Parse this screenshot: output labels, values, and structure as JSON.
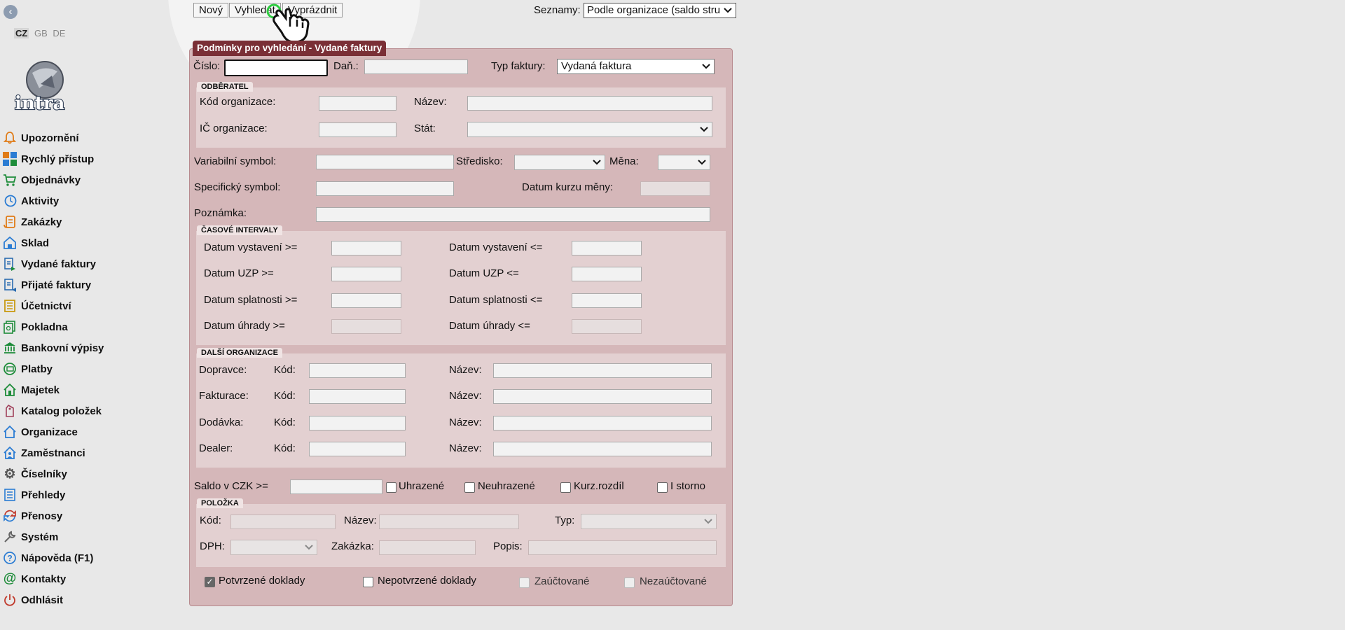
{
  "sidebar": {
    "back_icon": "chevron-left-icon",
    "languages": [
      {
        "code": "CZ",
        "current": true
      },
      {
        "code": "GB",
        "current": false
      },
      {
        "code": "DE",
        "current": false
      }
    ],
    "logo_text": "intra",
    "items": [
      {
        "label": "Upozornění",
        "icon": "bell-icon",
        "color": "#e07b16"
      },
      {
        "label": "Rychlý přístup",
        "icon": "tiles-icon",
        "color": "#2b7cd3"
      },
      {
        "label": "Objednávky",
        "icon": "cart-icon",
        "color": "#1e8c3a"
      },
      {
        "label": "Aktivity",
        "icon": "clock-icon",
        "color": "#2b7cd3"
      },
      {
        "label": "Zakázky",
        "icon": "clipboard-icon",
        "color": "#e07b16"
      },
      {
        "label": "Sklad",
        "icon": "warehouse-icon",
        "color": "#2b7cd3"
      },
      {
        "label": "Vydané faktury",
        "icon": "invoice-out-icon",
        "color": "#2b6cb0"
      },
      {
        "label": "Přijaté faktury",
        "icon": "invoice-in-icon",
        "color": "#2b6cb0"
      },
      {
        "label": "Účetnictví",
        "icon": "ledger-icon",
        "color": "#c89a10"
      },
      {
        "label": "Pokladna",
        "icon": "cash-icon",
        "color": "#1e8c3a"
      },
      {
        "label": "Bankovní výpisy",
        "icon": "bank-icon",
        "color": "#1e8c3a"
      },
      {
        "label": "Platby",
        "icon": "coins-icon",
        "color": "#1e8c3a"
      },
      {
        "label": "Majetek",
        "icon": "house-icon",
        "color": "#1e8c3a"
      },
      {
        "label": "Katalog položek",
        "icon": "tag-icon",
        "color": "#a0405a"
      },
      {
        "label": "Organizace",
        "icon": "building-icon",
        "color": "#2b7cd3"
      },
      {
        "label": "Zaměstnanci",
        "icon": "people-icon",
        "color": "#2b7cd3"
      },
      {
        "label": "Číselníky",
        "icon": "gear-icon",
        "color": "#555555"
      },
      {
        "label": "Přehledy",
        "icon": "list-icon",
        "color": "#2b7cd3"
      },
      {
        "label": "Přenosy",
        "icon": "sync-icon",
        "color": "#c0392b"
      },
      {
        "label": "Systém",
        "icon": "wrench-icon",
        "color": "#666666"
      },
      {
        "label": "Nápověda (F1)",
        "icon": "help-icon",
        "color": "#2b7cd3"
      },
      {
        "label": "Kontakty",
        "icon": "at-icon",
        "color": "#1e8c3a"
      },
      {
        "label": "Odhlásit",
        "icon": "power-icon",
        "color": "#c0392b"
      }
    ]
  },
  "toolbar": {
    "new_label": "Nový",
    "search_label": "Vyhledat",
    "clear_label": "Vyprázdnit",
    "lists_label": "Seznamy:",
    "lists_value": "Podle organizace (saldo stru"
  },
  "form": {
    "title": "Podmínky pro vyhledání - Vydané faktury",
    "number_label": "Číslo:",
    "number_value": "",
    "tax_label": "Daň.:",
    "invoice_type_label": "Typ faktury:",
    "invoice_type_value": "Vydaná faktura",
    "customer": {
      "section_label": "ODBĚRATEL",
      "org_code_label": "Kód organizace:",
      "name_label": "Název:",
      "org_id_label": "IČ organizace:",
      "country_label": "Stát:"
    },
    "variable_symbol_label": "Variabilní symbol:",
    "center_label": "Středisko:",
    "currency_label": "Měna:",
    "specific_symbol_label": "Specifický symbol:",
    "rate_date_label": "Datum kurzu měny:",
    "note_label": "Poznámka:",
    "intervals": {
      "section_label": "ČASOVÉ INTERVALY",
      "issue_from": "Datum vystavení >=",
      "issue_to": "Datum vystavení <=",
      "uzp_from": "Datum UZP >=",
      "uzp_to": "Datum UZP <=",
      "due_from": "Datum splatnosti >=",
      "due_to": "Datum splatnosti <=",
      "paid_from": "Datum úhrady >=",
      "paid_to": "Datum úhrady <="
    },
    "other_orgs": {
      "section_label": "DALŠÍ ORGANIZACE",
      "code_label": "Kód:",
      "name_label": "Název:",
      "rows": [
        "Dopravce:",
        "Fakturace:",
        "Dodávka:",
        "Dealer:"
      ]
    },
    "balance_label": "Saldo v CZK >=",
    "paid_label": "Uhrazené",
    "unpaid_label": "Neuhrazené",
    "rate_diff_label": "Kurz.rozdíl",
    "storno_label": "I storno",
    "item": {
      "section_label": "POLOŽKA",
      "code_label": "Kód:",
      "name_label": "Název:",
      "type_label": "Typ:",
      "vat_label": "DPH:",
      "order_label": "Zakázka:",
      "desc_label": "Popis:"
    },
    "confirmed_label": "Potvrzené doklady",
    "unconfirmed_label": "Nepotvrzené doklady",
    "accounted_label": "Zaúčtované",
    "unaccounted_label": "Nezaúčtované"
  },
  "colors": {
    "form_header": "#7a2f36",
    "form_bg": "#d5b7b9",
    "section_bg": "#e3d0d1"
  }
}
